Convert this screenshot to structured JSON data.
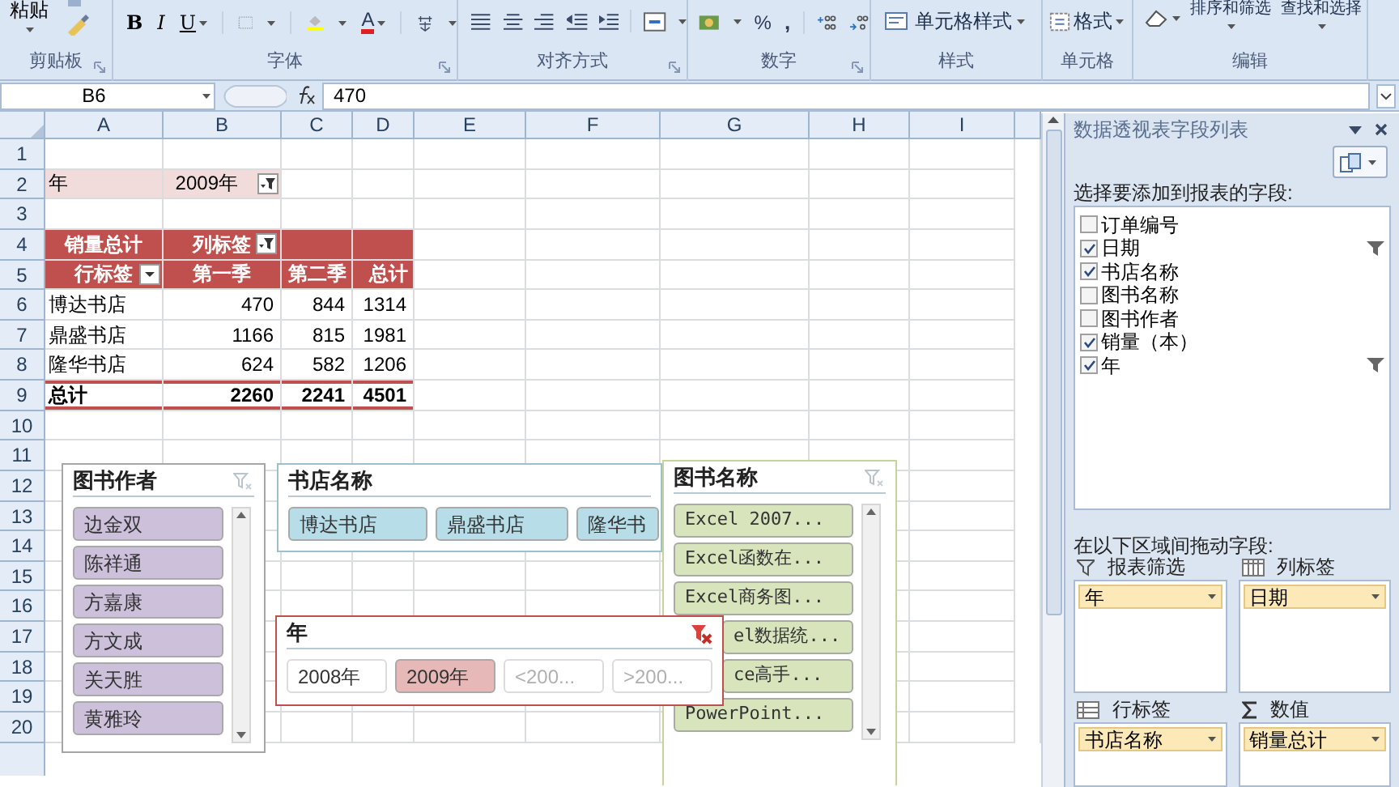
{
  "ribbon": {
    "groups": [
      {
        "label": "剪贴板",
        "launcher": true,
        "buttons": [
          {
            "label": "粘贴"
          }
        ]
      },
      {
        "label": "字体",
        "launcher": true,
        "buttons": [
          {
            "label": "B"
          },
          {
            "label": "I"
          },
          {
            "label": "U"
          },
          {
            "label": "A"
          }
        ]
      },
      {
        "label": "对齐方式",
        "launcher": true
      },
      {
        "label": "数字",
        "launcher": true,
        "buttons": [
          {
            "label": "%"
          },
          {
            "label": ","
          }
        ]
      },
      {
        "label": "样式",
        "launcher": false,
        "buttons": [
          {
            "label": "单元格样式"
          }
        ]
      },
      {
        "label": "单元格",
        "launcher": false,
        "buttons": [
          {
            "label": "格式"
          }
        ]
      },
      {
        "label": "编辑",
        "launcher": false,
        "buttons": [
          {
            "label": "排序和筛选"
          },
          {
            "label": "查找和选择"
          }
        ]
      }
    ]
  },
  "formula_bar": {
    "name_box": "B6",
    "formula": "470"
  },
  "sheet": {
    "columns": [
      "A",
      "B",
      "C",
      "D",
      "E",
      "F",
      "G",
      "H",
      "I"
    ],
    "rows": [
      "1",
      "2",
      "3",
      "4",
      "5",
      "6",
      "7",
      "8",
      "9",
      "10",
      "11",
      "12",
      "13",
      "14",
      "15",
      "16",
      "17",
      "18",
      "19",
      "20"
    ]
  },
  "pivot": {
    "filter": {
      "label": "年",
      "value": "2009年"
    },
    "value_label": "销量总计",
    "column_label": "列标签",
    "row_label": "行标签",
    "columns": [
      "第一季",
      "第二季",
      "总计"
    ],
    "rows": [
      {
        "label": "博达书店",
        "values": [
          "470",
          "844",
          "1314"
        ]
      },
      {
        "label": "鼎盛书店",
        "values": [
          "1166",
          "815",
          "1981"
        ]
      },
      {
        "label": "隆华书店",
        "values": [
          "624",
          "582",
          "1206"
        ]
      }
    ],
    "total": {
      "label": "总计",
      "values": [
        "2260",
        "2241",
        "4501"
      ]
    }
  },
  "slicers": [
    {
      "title": "图书作者",
      "kind": "vertical",
      "color": "#ccc0da",
      "filtered": false,
      "items": [
        {
          "label": "边金双",
          "selected": true,
          "disabled": false
        },
        {
          "label": "陈祥通",
          "selected": true,
          "disabled": false
        },
        {
          "label": "方嘉康",
          "selected": true,
          "disabled": false
        },
        {
          "label": "方文成",
          "selected": true,
          "disabled": false
        },
        {
          "label": "关天胜",
          "selected": true,
          "disabled": false
        },
        {
          "label": "黄雅玲",
          "selected": true,
          "disabled": false
        }
      ]
    },
    {
      "title": "书店名称",
      "kind": "horizontal",
      "color": "#b7dee8",
      "filtered": false,
      "items": [
        {
          "label": "博达书店",
          "selected": true,
          "disabled": false
        },
        {
          "label": "鼎盛书店",
          "selected": true,
          "disabled": false
        },
        {
          "label": "隆华书",
          "selected": true,
          "disabled": false
        }
      ]
    },
    {
      "title": "图书名称",
      "kind": "vertical",
      "color": "#d8e4bc",
      "filtered": false,
      "items": [
        {
          "label": "Excel 2007...",
          "selected": true,
          "disabled": false,
          "covered": false
        },
        {
          "label": "Excel函数在...",
          "selected": true,
          "disabled": false,
          "covered": false
        },
        {
          "label": "Excel商务图...",
          "selected": true,
          "disabled": false,
          "covered": false
        },
        {
          "label": "el数据统...",
          "selected": true,
          "disabled": false,
          "covered": true
        },
        {
          "label": "ce高手...",
          "selected": true,
          "disabled": false,
          "covered": true
        },
        {
          "label": "PowerPoint...",
          "selected": true,
          "disabled": false,
          "covered": false
        }
      ]
    },
    {
      "title": "年",
      "kind": "horizontal",
      "color": "#e6b8b7",
      "filtered": true,
      "items": [
        {
          "label": "2008年",
          "selected": false,
          "disabled": false
        },
        {
          "label": "2009年",
          "selected": true,
          "disabled": false
        },
        {
          "label": "<200...",
          "selected": false,
          "disabled": true
        },
        {
          "label": ">200...",
          "selected": false,
          "disabled": true
        }
      ]
    }
  ],
  "field_list": {
    "title": "数据透视表字段列表",
    "choose_label": "选择要添加到报表的字段:",
    "fields": [
      {
        "label": "订单编号",
        "checked": false,
        "filtered": false
      },
      {
        "label": "日期",
        "checked": true,
        "filtered": true
      },
      {
        "label": "书店名称",
        "checked": true,
        "filtered": false
      },
      {
        "label": "图书名称",
        "checked": false,
        "filtered": false
      },
      {
        "label": "图书作者",
        "checked": false,
        "filtered": false
      },
      {
        "label": "销量（本）",
        "checked": true,
        "filtered": false
      },
      {
        "label": "年",
        "checked": true,
        "filtered": true
      }
    ],
    "drag_label": "在以下区域间拖动字段:",
    "areas": [
      {
        "label": "报表筛选",
        "fields": [
          "年"
        ]
      },
      {
        "label": "列标签",
        "fields": [
          "日期"
        ]
      },
      {
        "label": "行标签",
        "fields": [
          "书店名称"
        ]
      },
      {
        "label": "数值",
        "fields": [
          "销量总计"
        ]
      }
    ]
  }
}
